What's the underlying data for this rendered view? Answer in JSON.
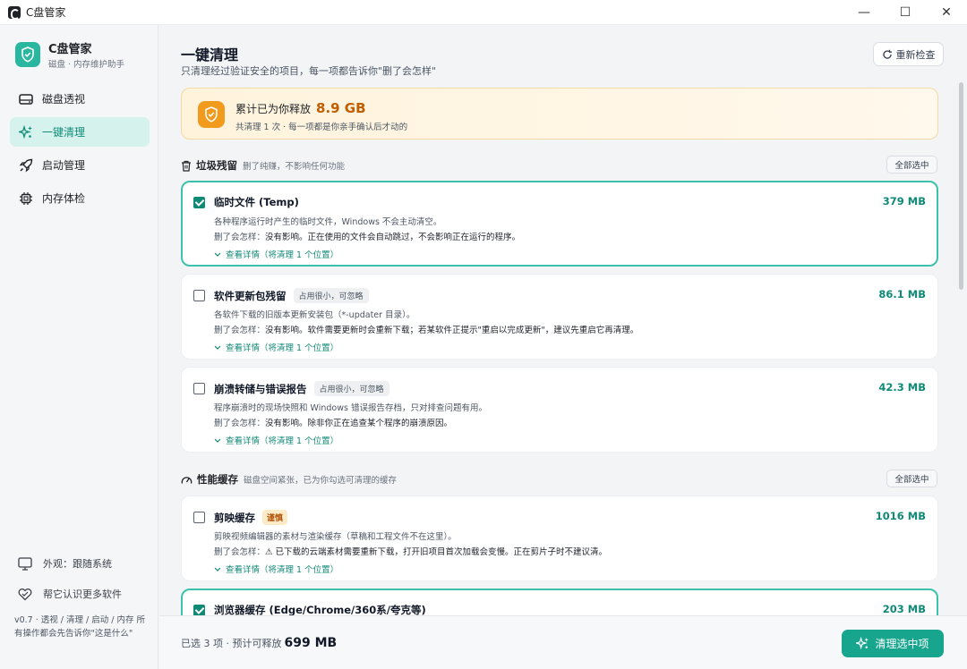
{
  "window": {
    "title": "C盘管家",
    "minimize": "—",
    "maximize": "☐",
    "close": "✕"
  },
  "sidebar": {
    "brand_name": "C盘管家",
    "brand_sub": "磁盘 · 内存维护助手",
    "items": [
      {
        "label": "磁盘透视",
        "icon": "disk-icon",
        "active": false
      },
      {
        "label": "一键清理",
        "icon": "sparkles-icon",
        "active": true
      },
      {
        "label": "启动管理",
        "icon": "rocket-icon",
        "active": false
      },
      {
        "label": "内存体检",
        "icon": "chip-icon",
        "active": false
      }
    ],
    "appearance_label": "外观：跟随系统",
    "learn_label": "帮它认识更多软件",
    "version_text": "v0.7 · 透视 / 清理 / 启动 / 内存 所有操作都会先告诉你\"这是什么\""
  },
  "main": {
    "title": "一键清理",
    "subtitle": "只清理经过验证安全的项目，每一项都告诉你\"删了会怎样\"",
    "recheck_label": "重新检查"
  },
  "banner": {
    "prefix": "累计已为你释放",
    "amount": "8.9 GB",
    "detail": "共清理 1 次 · 每一项都是你亲手确认后才动的"
  },
  "sections": [
    {
      "title": "垃圾残留",
      "note": "删了纯赚，不影响任何功能",
      "select_all": "全部选中",
      "icon": "trash-icon"
    },
    {
      "title": "性能缓存",
      "note": "磁盘空间紧张，已为你勾选可清理的缓存",
      "select_all": "全部选中",
      "icon": "gauge-icon"
    }
  ],
  "items": [
    {
      "title": "临时文件 (Temp)",
      "tag": "",
      "size": "379 MB",
      "checked": true,
      "desc": "各种程序运行时产生的临时文件，Windows 不会主动清空。",
      "effect_label": "删了会怎样：",
      "effect": "没有影响。正在使用的文件会自动跳过，不会影响正在运行的程序。",
      "detail": "查看详情（将清理 1 个位置）"
    },
    {
      "title": "软件更新包残留",
      "tag": "占用很小，可忽略",
      "size": "86.1 MB",
      "checked": false,
      "desc": "各软件下载的旧版本更新安装包（*-updater 目录）。",
      "effect_label": "删了会怎样：",
      "effect": "没有影响。软件需要更新时会重新下载；若某软件正提示\"重启以完成更新\"，建议先重启它再清理。",
      "detail": "查看详情（将清理 1 个位置）"
    },
    {
      "title": "崩溃转储与错误报告",
      "tag": "占用很小，可忽略",
      "size": "42.3 MB",
      "checked": false,
      "desc": "程序崩溃时的现场快照和 Windows 错误报告存档，只对排查问题有用。",
      "effect_label": "删了会怎样：",
      "effect": "没有影响。除非你正在追查某个程序的崩溃原因。",
      "detail": "查看详情（将清理 1 个位置）"
    },
    {
      "title": "剪映缓存",
      "tag": "谨慎",
      "size": "1016 MB",
      "checked": false,
      "desc": "剪映视频编辑器的素材与渲染缓存（草稿和工程文件不在这里）。",
      "effect_label": "删了会怎样：",
      "effect": "⚠ 已下载的云端素材需要重新下载，打开旧项目首次加载会变慢。正在剪片子时不建议清。",
      "detail": "查看详情（将清理 1 个位置）"
    },
    {
      "title": "浏览器缓存 (Edge/Chrome/360系/夸克等)",
      "tag": "",
      "size": "203 MB",
      "checked": true
    }
  ],
  "footer": {
    "prefix": "已选 3 项 · 预计可释放",
    "size": "699 MB",
    "button": "清理选中项"
  },
  "colors": {
    "accent": "#18a58e",
    "accent_light": "#d5f2ec",
    "banner_amount": "#c25e00",
    "warn_tag": "#b45309"
  }
}
